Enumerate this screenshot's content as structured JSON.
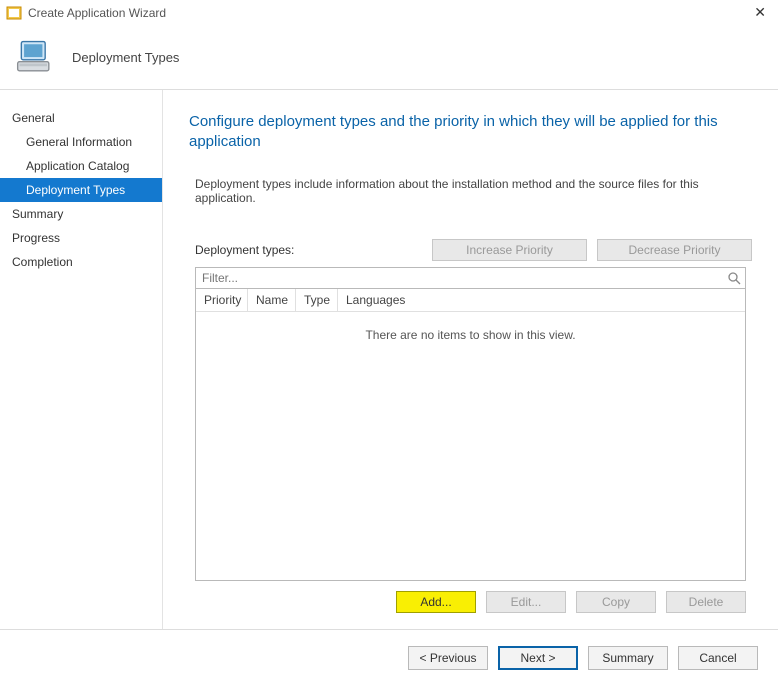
{
  "window": {
    "title": "Create Application Wizard"
  },
  "header": {
    "title": "Deployment Types"
  },
  "sidebar": {
    "items": [
      {
        "label": "General",
        "sub": false,
        "selected": false
      },
      {
        "label": "General Information",
        "sub": true,
        "selected": false
      },
      {
        "label": "Application Catalog",
        "sub": true,
        "selected": false
      },
      {
        "label": "Deployment Types",
        "sub": true,
        "selected": true
      },
      {
        "label": "Summary",
        "sub": false,
        "selected": false
      },
      {
        "label": "Progress",
        "sub": false,
        "selected": false
      },
      {
        "label": "Completion",
        "sub": false,
        "selected": false
      }
    ]
  },
  "main": {
    "heading": "Configure deployment types and the priority in which they will be applied for this application",
    "description": "Deployment types include information about the installation method and the source files for this application.",
    "deployment_types_label": "Deployment types:",
    "increase_priority": "Increase Priority",
    "decrease_priority": "Decrease Priority",
    "filter_placeholder": "Filter...",
    "columns": {
      "priority": "Priority",
      "name": "Name",
      "type": "Type",
      "languages": "Languages"
    },
    "empty_text": "There are no items to show in this view.",
    "buttons": {
      "add": "Add...",
      "edit": "Edit...",
      "copy": "Copy",
      "delete": "Delete"
    }
  },
  "footer": {
    "previous": "< Previous",
    "next": "Next >",
    "summary": "Summary",
    "cancel": "Cancel"
  }
}
